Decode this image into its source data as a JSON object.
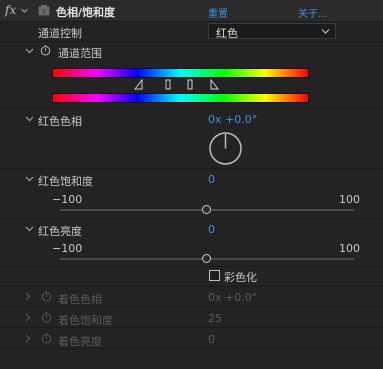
{
  "header": {
    "fx_label": "fx",
    "effect_name": "色相/饱和度",
    "reset_label": "重置",
    "about_label": "关于..."
  },
  "channel_control": {
    "label": "通道控制",
    "value": "红色"
  },
  "channel_range": {
    "label": "通道范围"
  },
  "hue": {
    "label": "红色色相",
    "value": "0x +0.0°"
  },
  "saturation": {
    "label": "红色饱和度",
    "value": "0",
    "min_label": "−100",
    "max_label": "100",
    "slider_value": 0,
    "slider_min": -100,
    "slider_max": 100
  },
  "lightness": {
    "label": "红色亮度",
    "value": "0",
    "min_label": "−100",
    "max_label": "100",
    "slider_value": 0,
    "slider_min": -100,
    "slider_max": 100
  },
  "colorize": {
    "label": "彩色化",
    "checked": false
  },
  "colorize_params": [
    {
      "label": "着色色相",
      "value": "0x +0.0°"
    },
    {
      "label": "着色饱和度",
      "value": "25"
    },
    {
      "label": "着色亮度",
      "value": "0"
    }
  ],
  "colors": {
    "accent": "#3d8fe0",
    "background": "#232323",
    "header": "#2b2b2b"
  }
}
